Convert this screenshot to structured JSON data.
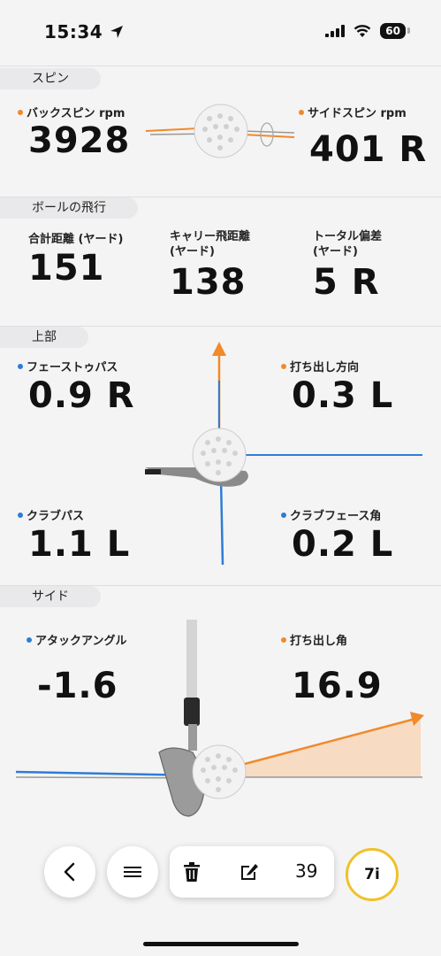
{
  "status": {
    "time": "15:34",
    "battery": "60"
  },
  "spin": {
    "section": "スピン",
    "backspin_label": "バックスピン rpm",
    "backspin_value": "3928",
    "sidespin_label": "サイドスピン rpm",
    "sidespin_value": "401 R"
  },
  "flight": {
    "section": "ボールの飛行",
    "total_label": "合計距離 (ヤード)",
    "total_value": "151",
    "carry_label_1": "キャリー飛距離",
    "carry_label_2": "(ヤード)",
    "carry_value": "138",
    "offline_label_1": "トータル偏差",
    "offline_label_2": "(ヤード)",
    "offline_value": "5 R"
  },
  "top": {
    "section": "上部",
    "face_to_path_label": "フェーストゥパス",
    "face_to_path_value": "0.9 R",
    "launch_dir_label": "打ち出し方向",
    "launch_dir_value": "0.3 L",
    "club_path_label": "クラブパス",
    "club_path_value": "1.1 L",
    "face_angle_label": "クラブフェース角",
    "face_angle_value": "0.2 L"
  },
  "side": {
    "section": "サイド",
    "attack_label": "アタックアングル",
    "attack_value": "-1.6",
    "launch_angle_label": "打ち出し角",
    "launch_angle_value": "16.9"
  },
  "toolbar": {
    "shot_count": "39",
    "club": "7i"
  },
  "colors": {
    "orange": "#f08a2b",
    "blue": "#2f7cd6",
    "club_ring": "#f0c12a"
  },
  "icons": [
    "location-arrow-icon",
    "signal-icon",
    "wifi-icon",
    "battery-icon",
    "back-chevron-icon",
    "menu-icon",
    "trash-icon",
    "edit-icon"
  ]
}
